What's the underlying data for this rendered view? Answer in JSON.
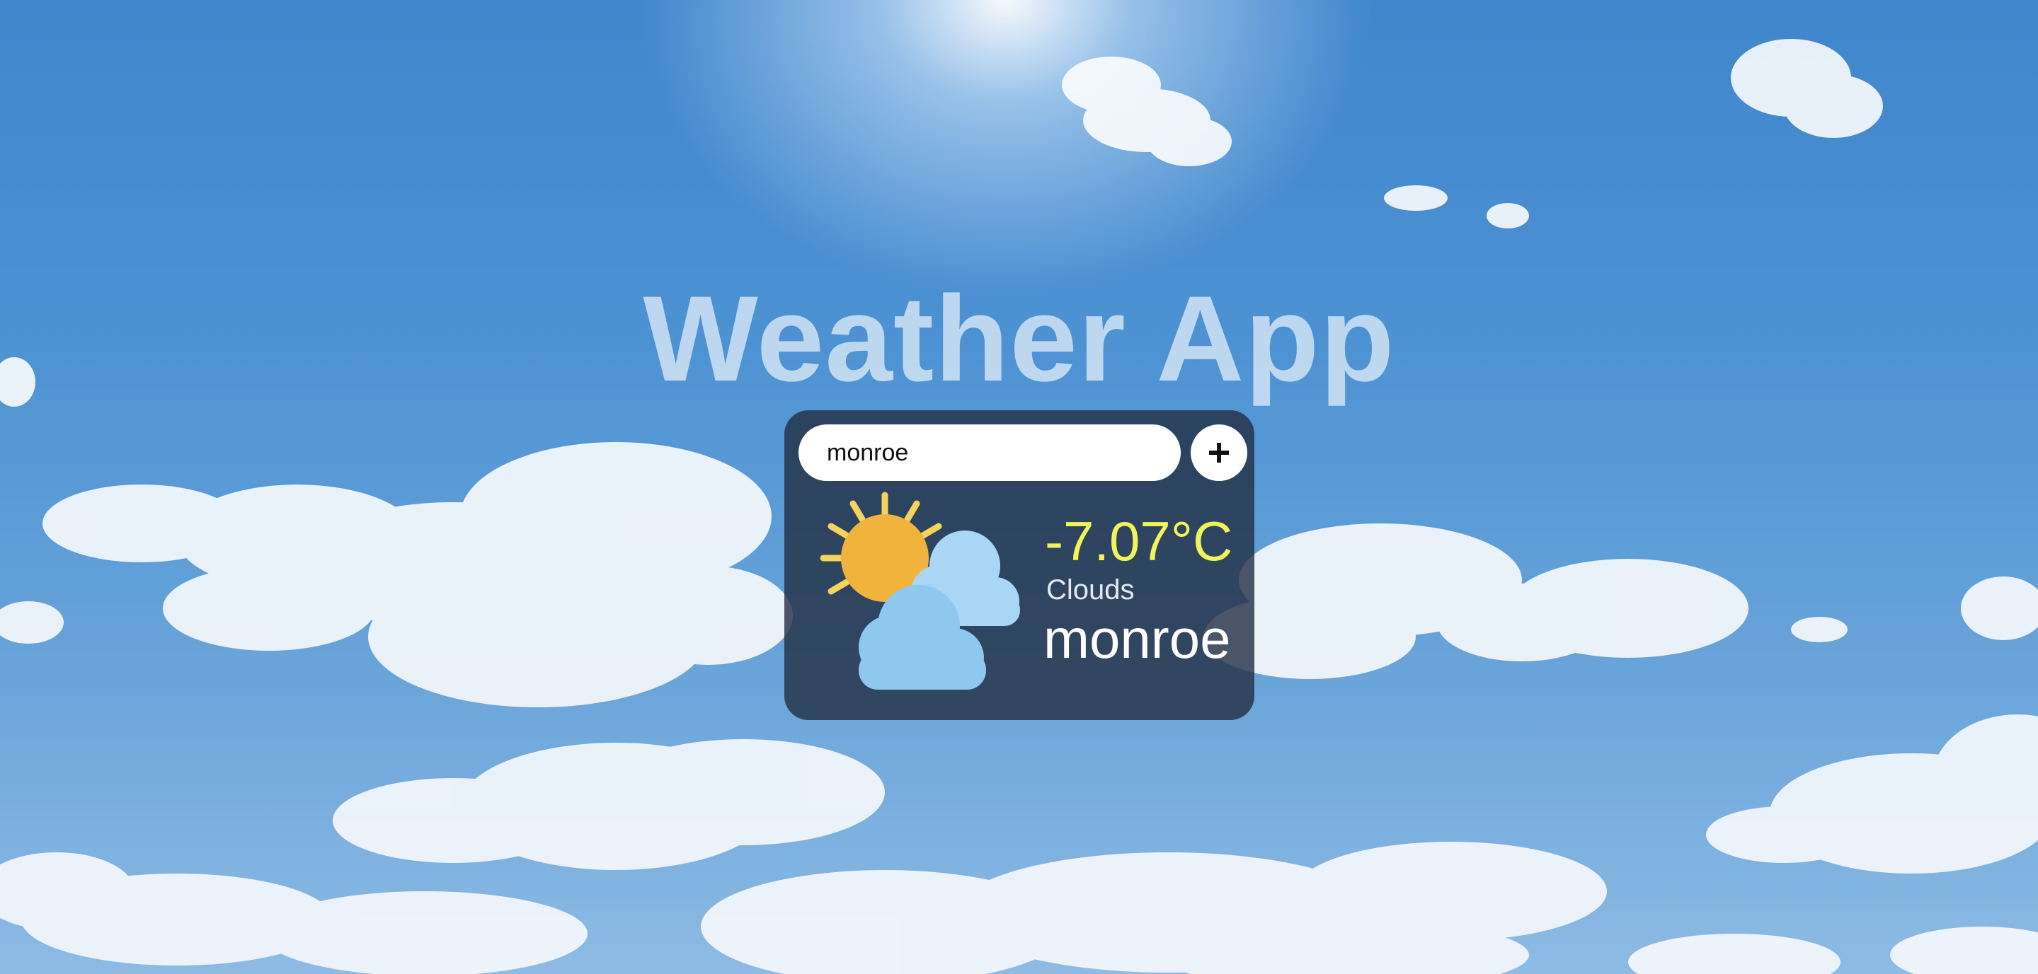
{
  "app": {
    "title": "Weather App"
  },
  "search": {
    "value": "monroe",
    "placeholder": ""
  },
  "add_button": {
    "icon": "plus-icon",
    "label": "+"
  },
  "weather": {
    "temperature": "-7.07°C",
    "condition": "Clouds",
    "city": "monroe",
    "icon": "sun-behind-clouds-icon"
  },
  "colors": {
    "temperature": "#f1f55a",
    "sun": "#f0b33c",
    "sun_rays": "#f5d45c",
    "cloud": "#8ec8ef",
    "cloud_back": "#a9d6f5",
    "card_background": "rgba(34,46,66,0.80)"
  }
}
